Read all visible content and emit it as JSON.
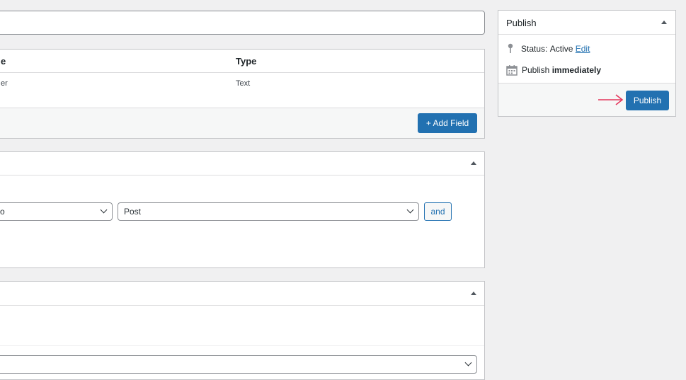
{
  "title_input": {
    "value": ""
  },
  "fields": {
    "columns": [
      "e",
      "Type"
    ],
    "rows": [
      {
        "label": "er",
        "type": "Text"
      }
    ],
    "add_field_label": "+ Add Field"
  },
  "location": {
    "param_select": "o",
    "value_select": "Post",
    "and_label": "and"
  },
  "publish": {
    "title": "Publish",
    "status_label": "Status:",
    "status_value": "Active",
    "edit_link": "Edit",
    "publish_label": "Publish",
    "publish_when": "immediately",
    "button_label": "Publish"
  },
  "colors": {
    "primary": "#2271b1",
    "arrow": "#e4365c"
  }
}
